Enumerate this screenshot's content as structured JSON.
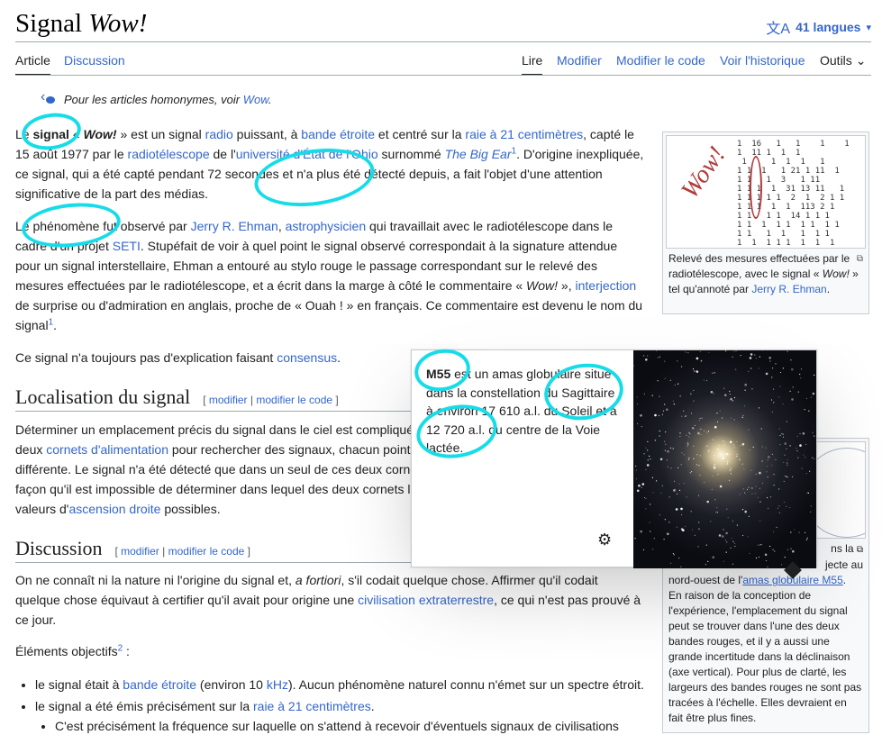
{
  "header": {
    "title_main": "Signal",
    "title_italic": "Wow!",
    "languages_label": "41 langues"
  },
  "tabs": {
    "left": [
      {
        "label": "Article",
        "selected": true
      },
      {
        "label": "Discussion",
        "selected": false
      }
    ],
    "right": [
      {
        "label": "Lire",
        "selected": true
      },
      {
        "label": "Modifier",
        "selected": false
      },
      {
        "label": "Modifier le code",
        "selected": false
      },
      {
        "label": "Voir l'historique",
        "selected": false
      },
      {
        "label": "Outils",
        "selected": false
      }
    ]
  },
  "hatnote": {
    "prefix": "Pour les articles homonymes, voir ",
    "link": "Wow",
    "suffix": "."
  },
  "intro": {
    "p1": {
      "t1": "Le ",
      "b1": "signal",
      "t2": " « ",
      "b2": "Wow!",
      "t3": " » est un signal ",
      "l1": "radio",
      "t4": " puissant, à ",
      "l2": "bande étroite",
      "t5": " et centré sur la ",
      "l3": "raie à 21 centimètres",
      "t6": ", capté le 15 août 1977 par le ",
      "l4": "radiotélescope",
      "t7": " de l'",
      "l5": "université d'État de l'Ohio",
      "t8": " surnommé ",
      "l6": "The Big Ear",
      "ref": "1",
      "t9": ". D'origine inexpliquée, ce signal, qui a été capté pendant 72 secondes et n'a plus été détecté depuis, a fait l'objet d'une attention significative de la part des médias."
    },
    "p2": {
      "t1": "Le phénomène fut observé par ",
      "l1": "Jerry R. Ehman",
      "t2": ", ",
      "l2": "astrophysicien",
      "t3": " qui travaillait avec le radiotélescope dans le cadre d'un projet ",
      "l3": "SETI",
      "t4": ". Stupéfait de voir à quel point le signal observé correspondait à la signature attendue pour un signal interstellaire, Ehman a entouré au stylo rouge le passage correspondant sur le relevé des mesures effectuées par le radiotélescope, et a écrit dans la marge à côté le commentaire « ",
      "i1": "Wow!",
      "t5": " », ",
      "l4": "interjection",
      "t6": " de surprise ou d'admiration en anglais, proche de « Ouah ! » en français. Ce commentaire est devenu le nom du signal",
      "ref": "1",
      "t7": "."
    },
    "p3": {
      "t1": "Ce signal n'a toujours pas d'explication faisant ",
      "l1": "consensus",
      "t2": "."
    }
  },
  "section_loc": {
    "title": "Localisation du signal",
    "edit": "modifier",
    "edit_code": "modifier le code",
    "p": {
      "t1": "Déterminer un emplacement précis du signal dans le ciel est compliqué",
      "t2": "deux ",
      "l1": "cornets d'alimentation",
      "t3": " pour rechercher des signaux, chacun pointa",
      "t4": "différente. Le signal n'a été détecté que dans un seul de ces deux corne",
      "t5": "façon qu'il est impossible de déterminer dans lequel des deux cornets le",
      "t6": "valeurs d'",
      "l2": "ascension droite",
      "t7": " possibles."
    }
  },
  "section_disc": {
    "title": "Discussion",
    "edit": "modifier",
    "edit_code": "modifier le code",
    "p1": {
      "t1": "On ne connaît ni la nature ni l'origine du signal et, ",
      "i1": "a fortiori",
      "t2": ", s'il codait quelque chose. Affirmer qu'il codait quelque chose équivaut à certifier qu'il avait pour origine une ",
      "l1": "civilisation extraterrestre",
      "t3": ", ce qui n'est pas prouvé à ce jour."
    },
    "p2": {
      "t1": "Éléments objectifs",
      "ref": "2",
      "t2": " :"
    },
    "bullets": [
      {
        "t1": "le signal était à ",
        "l1": "bande étroite",
        "t2": " (environ 10 ",
        "l2": "kHz",
        "t3": "). Aucun phénomène naturel connu n'émet sur un spectre étroit."
      },
      {
        "t1": "le signal a été émis précisément sur la ",
        "l1": "raie à 21 centimètres",
        "t2": "."
      }
    ],
    "sub_bullet": "C'est précisément la fréquence sur laquelle on s'attend à recevoir d'éventuels signaux de civilisations"
  },
  "thumb1": {
    "caption_t1": "Relevé des mesures effectuées par le radiotélescope, avec le signal « ",
    "caption_i": "Wow!",
    "caption_t2": " » tel qu'annoté par ",
    "caption_l": "Jerry R. Ehman",
    "caption_t3": ".",
    "printout": "1  16   1   1    1    1\n1  11 1  1  1\n 1     1  1  1   1\n1 1  1   1 21 1 11  1\n1 1   1  3   1 11\n1 1 1  1  31 13 11   1\n1 1 1 1 1  2  1  2 1 1\n1 1 1  1  1  113 2 1\n1 1   1 1  14 1 1 1\n1 1  1  1 1  1 1  1 1\n1 1   1  1   1  1 1\n1  1  1 1 1  1  1  1\n  1  1   1  11  1",
    "wow_mark": "Wow!"
  },
  "thumb2": {
    "cap_a": "ns la",
    "cap_b": "jecte au",
    "cap_c_t1": "nord-ouest de l'",
    "cap_c_l": "amas globulaire M55",
    "cap_c_t2": ".",
    "cap_d": "En raison de la conception de l'expérience, l'emplacement du signal peut se trouver dans l'une des deux bandes rouges, et il y a aussi une grande incertitude dans la déclinaison (axe vertical). Pour plus de clarté, les largeurs des bandes rouges ne sont pas tracées à l'échelle. Elles devraient en fait être plus fines."
  },
  "popup": {
    "b1": "M55",
    "t1": " est un amas globulaire situé dans la constellation du ",
    "l1": "Sagittaire",
    "t2": " à environ 17 610 a.l. du Soleil et à 12 720 a.l. du centre de la Voie lactée."
  }
}
